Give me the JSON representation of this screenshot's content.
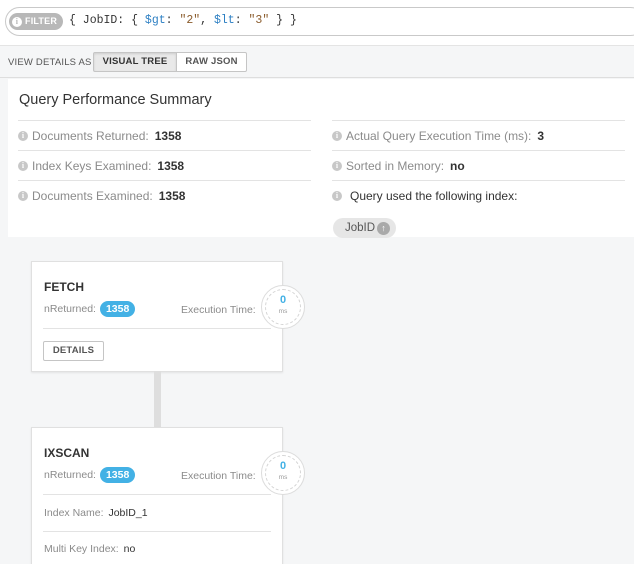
{
  "filter": {
    "badge": "FILTER",
    "text_open": "{ JobID: { ",
    "gt_key": "$gt",
    "gt_sep": ": ",
    "gt_value": "\"2\"",
    "comma": ", ",
    "lt_key": "$lt",
    "lt_sep": ": ",
    "lt_value": "\"3\"",
    "text_close": " } }"
  },
  "view_details": {
    "label": "VIEW DETAILS AS",
    "visual_tree": "VISUAL TREE",
    "raw_json": "RAW JSON",
    "selected": "VISUAL TREE"
  },
  "summary": {
    "title": "Query Performance Summary",
    "documents_returned": {
      "label": "Documents Returned:",
      "value": "1358"
    },
    "index_keys_examined": {
      "label": "Index Keys Examined:",
      "value": "1358"
    },
    "documents_examined": {
      "label": "Documents Examined:",
      "value": "1358"
    },
    "execution_time": {
      "label": "Actual Query Execution Time (ms):",
      "value": "3"
    },
    "sorted_in_memory": {
      "label": "Sorted in Memory:",
      "value": "no"
    },
    "index_used": {
      "label": "Query used the following index:",
      "index_name": "JobID"
    }
  },
  "stages": [
    {
      "name": "FETCH",
      "nreturned_label": "nReturned:",
      "nreturned": "1358",
      "exec_label": "Execution Time:",
      "exec_ms": "0",
      "exec_unit": "ms",
      "details_button": "DETAILS"
    },
    {
      "name": "IXSCAN",
      "nreturned_label": "nReturned:",
      "nreturned": "1358",
      "exec_label": "Execution Time:",
      "exec_ms": "0",
      "exec_unit": "ms",
      "index_name_label": "Index Name:",
      "index_name": "JobID_1",
      "multi_key_label": "Multi Key Index:",
      "multi_key": "no"
    }
  ],
  "icons": {
    "info": "info-icon",
    "sort_asc": "arrow-up-icon"
  },
  "colors": {
    "accent": "#43b1e5",
    "filter_badge": "#b8b8b8"
  }
}
